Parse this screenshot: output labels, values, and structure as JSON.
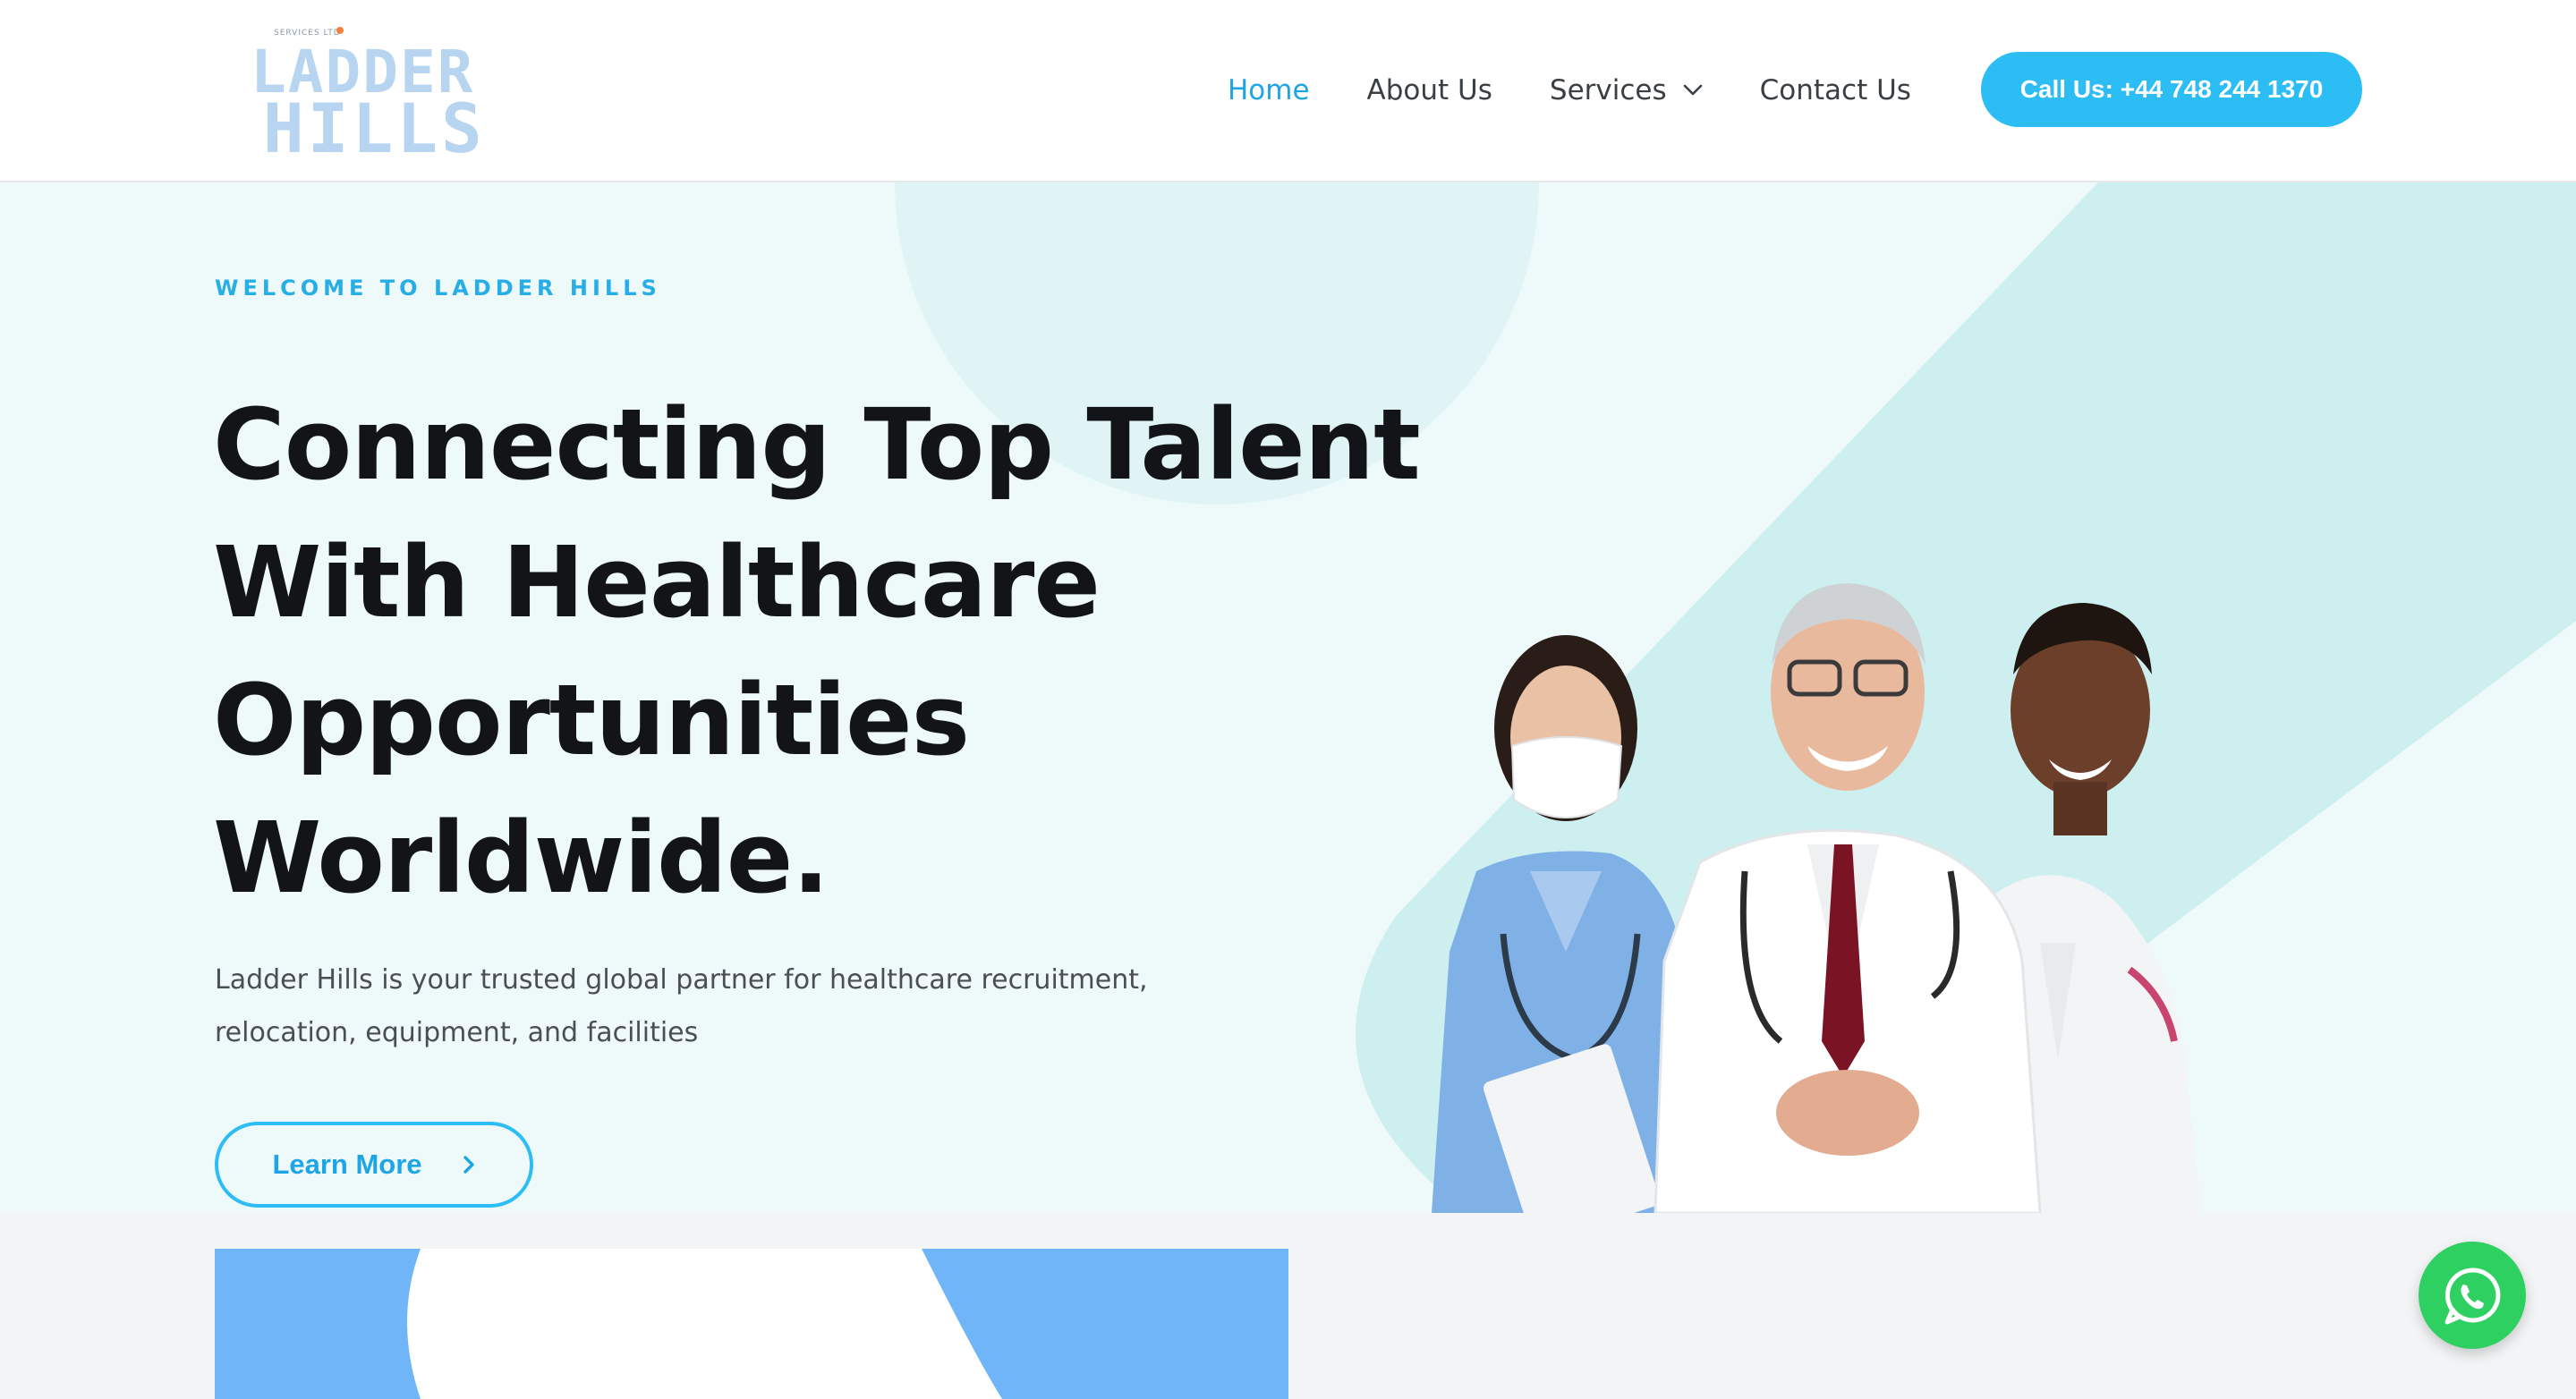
{
  "header": {
    "logo": {
      "small_text": "SERVICES LTD",
      "line1": "LADDER",
      "line2": "HILLS"
    },
    "nav": [
      {
        "label": "Home",
        "active": true
      },
      {
        "label": "About Us",
        "active": false
      },
      {
        "label": "Services",
        "active": false,
        "has_dropdown": true
      },
      {
        "label": "Contact Us",
        "active": false
      }
    ],
    "cta_label": "Call Us: +44 748 244 1370"
  },
  "hero": {
    "eyebrow": "WELCOME TO LADDER HILLS",
    "headline": [
      "Connecting Top Talent",
      "With Healthcare",
      "Opportunities",
      "Worldwide."
    ],
    "subtext": [
      "Ladder Hills is your trusted global partner for healthcare recruitment,",
      "relocation, equipment, and facilities"
    ],
    "learn_more_label": "Learn More"
  },
  "icons": {
    "services_dropdown": "chevron-down-icon",
    "learn_more": "chevron-right-icon",
    "floating_chat": "whatsapp-icon"
  },
  "colors": {
    "accent": "#2bbdf4",
    "nav_active": "#1ea5e6",
    "hero_bg": "#eef9fa",
    "hero_shape": "#cdeff0",
    "whatsapp": "#2fd062",
    "feature_blue": "#6fb5f7"
  }
}
